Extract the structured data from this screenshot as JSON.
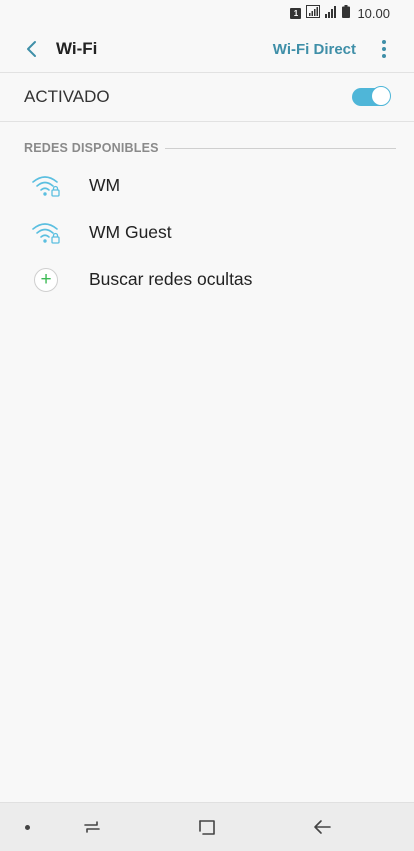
{
  "status_bar": {
    "sim_slot": "1",
    "time": "10.00"
  },
  "header": {
    "title": "Wi-Fi",
    "wifi_direct_label": "Wi-Fi Direct"
  },
  "master_switch": {
    "label": "ACTIVADO",
    "state": "on"
  },
  "available_networks": {
    "title": "REDES DISPONIBLES",
    "items": [
      {
        "label": "WM",
        "icon": "wifi-lock-icon",
        "secured": true
      },
      {
        "label": "WM Guest",
        "icon": "wifi-lock-icon",
        "secured": true
      },
      {
        "label": "Buscar redes ocultas",
        "icon": "plus-icon"
      }
    ]
  },
  "colors": {
    "accent": "#3f8fa8",
    "toggle_on": "#4fb6d8",
    "wifi_icon": "#5bbfe0",
    "plus": "#3cba54"
  }
}
